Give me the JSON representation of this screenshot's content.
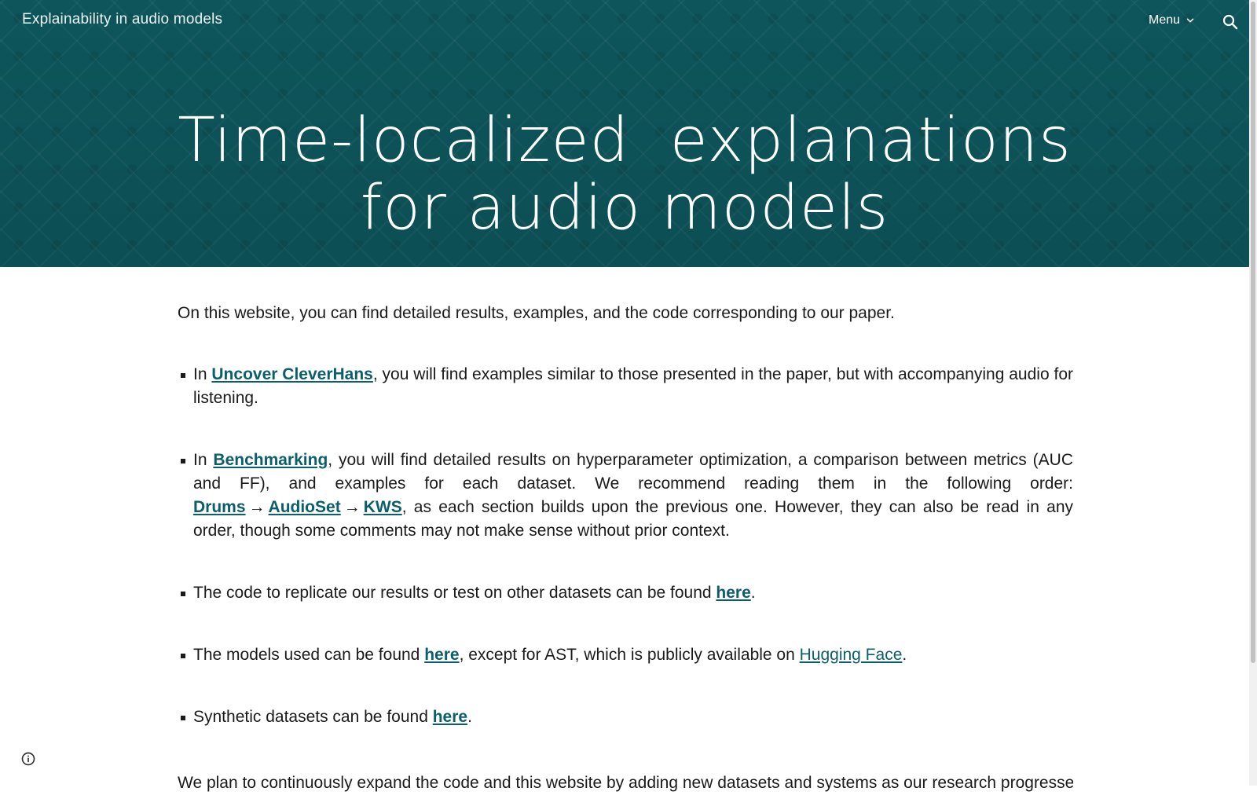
{
  "header": {
    "site_title": "Explainability in audio models",
    "menu_label": "Menu",
    "search_icon": "search-icon",
    "menu_icon": "chevron-down-icon",
    "background_color": "#0e5a60"
  },
  "hero": {
    "title_line1": "Time-localized  explanations",
    "title_line2": "for audio models"
  },
  "content": {
    "intro": "On this website, you can find detailed results, examples, and the code corresponding to our paper.",
    "items": [
      {
        "prefix": "In ",
        "link": "Uncover CleverHans",
        "suffix": ", you will find examples similar to those presented in the paper, but with accompanying audio for listening."
      },
      {
        "prefix": "In ",
        "link": "Benchmarking",
        "middle": ", you will find detailed results on hyperparameter optimization, a comparison between metrics (AUC and FF), and examples for each dataset. We recommend reading them in the following order: ",
        "order_links": [
          "Drums",
          "AudioSet",
          "KWS"
        ],
        "arrow": "→",
        "suffix": ", as each section builds upon the previous one. However, they can also be read in any order, though some comments may not make sense without prior context."
      },
      {
        "prefix": "The code to replicate our results or test on other datasets can be found ",
        "link": "here",
        "suffix": "."
      },
      {
        "prefix": "The models used can be found ",
        "link": "here",
        "middle": ", except for AST, which is publicly available on ",
        "link2": "Hugging Face",
        "suffix": "."
      },
      {
        "prefix": "Synthetic datasets can be found ",
        "link": "here",
        "suffix": "."
      }
    ],
    "footer": "We plan to continuously expand the code and this website by adding new datasets and systems as our research progresses."
  },
  "icons": {
    "info": "info-icon"
  },
  "colors": {
    "link": "#0b5f6a",
    "text": "#1a1a1a"
  }
}
